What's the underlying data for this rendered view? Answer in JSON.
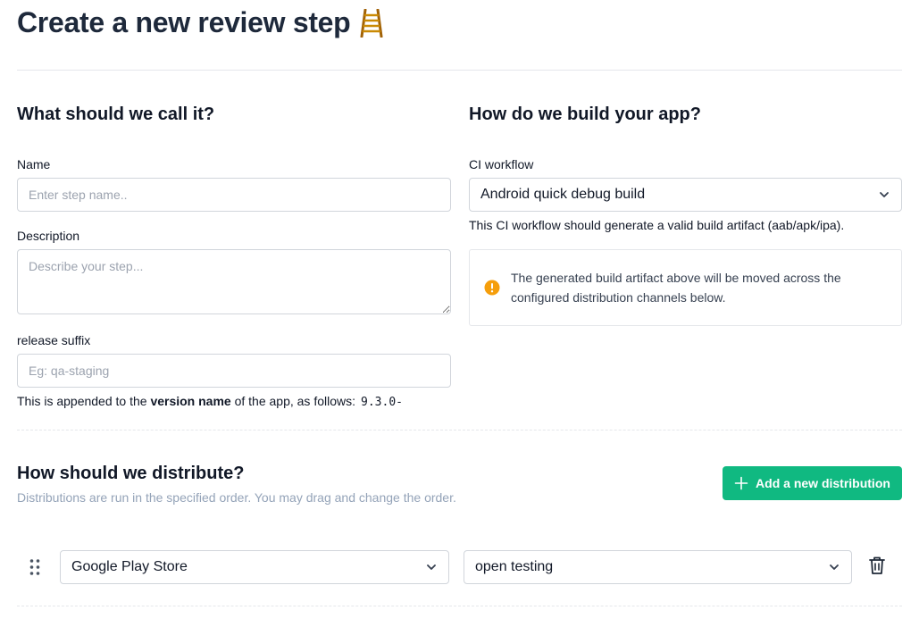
{
  "page": {
    "title": "Create a new review step",
    "title_icon": "ladder-icon"
  },
  "naming": {
    "heading": "What should we call it?",
    "name_label": "Name",
    "name_placeholder": "Enter step name..",
    "name_value": "",
    "description_label": "Description",
    "description_placeholder": "Describe your step...",
    "description_value": "",
    "suffix_label": "release suffix",
    "suffix_placeholder": "Eg: qa-staging",
    "suffix_value": "",
    "suffix_help_prefix": "This is appended to the ",
    "suffix_help_bold": "version name",
    "suffix_help_suffix": " of the app, as follows:",
    "suffix_example": "9.3.0-"
  },
  "build": {
    "heading": "How do we build your app?",
    "ci_label": "CI workflow",
    "ci_selected": "Android quick debug build",
    "ci_help": "This CI workflow should generate a valid build artifact (aab/apk/ipa).",
    "info_text": "The generated build artifact above will be moved across the configured distribution channels below.",
    "info_icon": "warning-circle-icon",
    "info_icon_color": "#f59e0b"
  },
  "distribution": {
    "heading": "How should we distribute?",
    "subtext": "Distributions are run in the specified order. You may drag and change the order.",
    "add_button_label": "Add a new distribution",
    "add_button_color": "#10b981",
    "items": [
      {
        "channel": "Google Play Store",
        "track": "open testing"
      }
    ]
  }
}
